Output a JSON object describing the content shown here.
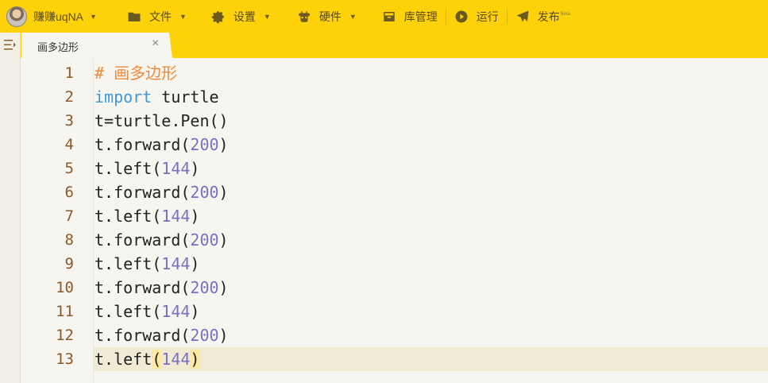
{
  "menubar": {
    "username": "赚赚uqNA",
    "file": "文件",
    "settings": "设置",
    "hardware": "硬件",
    "library": "库管理",
    "run": "运行",
    "publish": "发布",
    "publish_badge": "Beta",
    "accent_color": "#fdd20a"
  },
  "tabs": [
    {
      "label": "画多边形",
      "close": "×"
    }
  ],
  "editor": {
    "lines": [
      {
        "n": "1",
        "segs": [
          {
            "t": "# 画多边形",
            "c": "cm"
          }
        ]
      },
      {
        "n": "2",
        "segs": [
          {
            "t": "import",
            "c": "kw"
          },
          {
            "t": " turtle",
            "c": ""
          }
        ]
      },
      {
        "n": "3",
        "segs": [
          {
            "t": "t=turtle.Pen()",
            "c": ""
          }
        ]
      },
      {
        "n": "4",
        "segs": [
          {
            "t": "t.forward(",
            "c": ""
          },
          {
            "t": "200",
            "c": "num"
          },
          {
            "t": ")",
            "c": ""
          }
        ]
      },
      {
        "n": "5",
        "segs": [
          {
            "t": "t.left(",
            "c": ""
          },
          {
            "t": "144",
            "c": "num"
          },
          {
            "t": ")",
            "c": ""
          }
        ]
      },
      {
        "n": "6",
        "segs": [
          {
            "t": "t.forward(",
            "c": ""
          },
          {
            "t": "200",
            "c": "num"
          },
          {
            "t": ")",
            "c": ""
          }
        ]
      },
      {
        "n": "7",
        "segs": [
          {
            "t": "t.left(",
            "c": ""
          },
          {
            "t": "144",
            "c": "num"
          },
          {
            "t": ")",
            "c": ""
          }
        ]
      },
      {
        "n": "8",
        "segs": [
          {
            "t": "t.forward(",
            "c": ""
          },
          {
            "t": "200",
            "c": "num"
          },
          {
            "t": ")",
            "c": ""
          }
        ]
      },
      {
        "n": "9",
        "segs": [
          {
            "t": "t.left(",
            "c": ""
          },
          {
            "t": "144",
            "c": "num"
          },
          {
            "t": ")",
            "c": ""
          }
        ]
      },
      {
        "n": "10",
        "segs": [
          {
            "t": "t.forward(",
            "c": ""
          },
          {
            "t": "200",
            "c": "num"
          },
          {
            "t": ")",
            "c": ""
          }
        ]
      },
      {
        "n": "11",
        "segs": [
          {
            "t": "t.left(",
            "c": ""
          },
          {
            "t": "144",
            "c": "num"
          },
          {
            "t": ")",
            "c": ""
          }
        ]
      },
      {
        "n": "12",
        "segs": [
          {
            "t": "t.forward(",
            "c": ""
          },
          {
            "t": "200",
            "c": "num"
          },
          {
            "t": ")",
            "c": ""
          }
        ]
      },
      {
        "n": "13",
        "segs": [
          {
            "t": "t.left",
            "c": ""
          },
          {
            "t": "(",
            "c": "pm"
          },
          {
            "t": "144",
            "c": "num"
          },
          {
            "t": ")",
            "c": "pm"
          }
        ],
        "active": true
      }
    ]
  }
}
